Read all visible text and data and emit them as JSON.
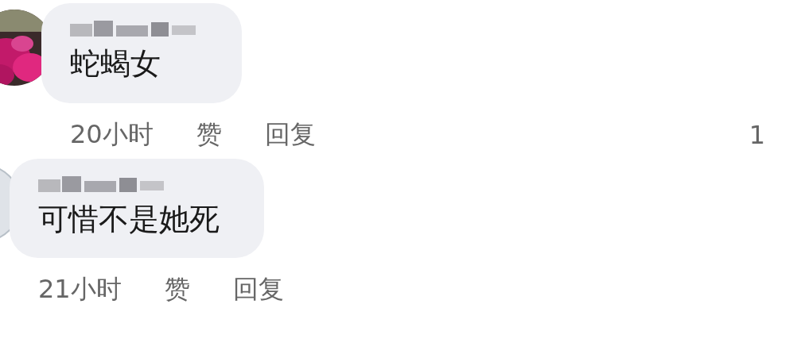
{
  "comments": [
    {
      "text": "蛇蝎女",
      "time": "20小时",
      "like": "赞",
      "reply": "回复",
      "reactions": "1"
    },
    {
      "avatar": {
        "kind": "plain"
      },
      "text": "可惜不是她死",
      "time": "21小时",
      "like": "赞",
      "reply": "回复"
    }
  ]
}
